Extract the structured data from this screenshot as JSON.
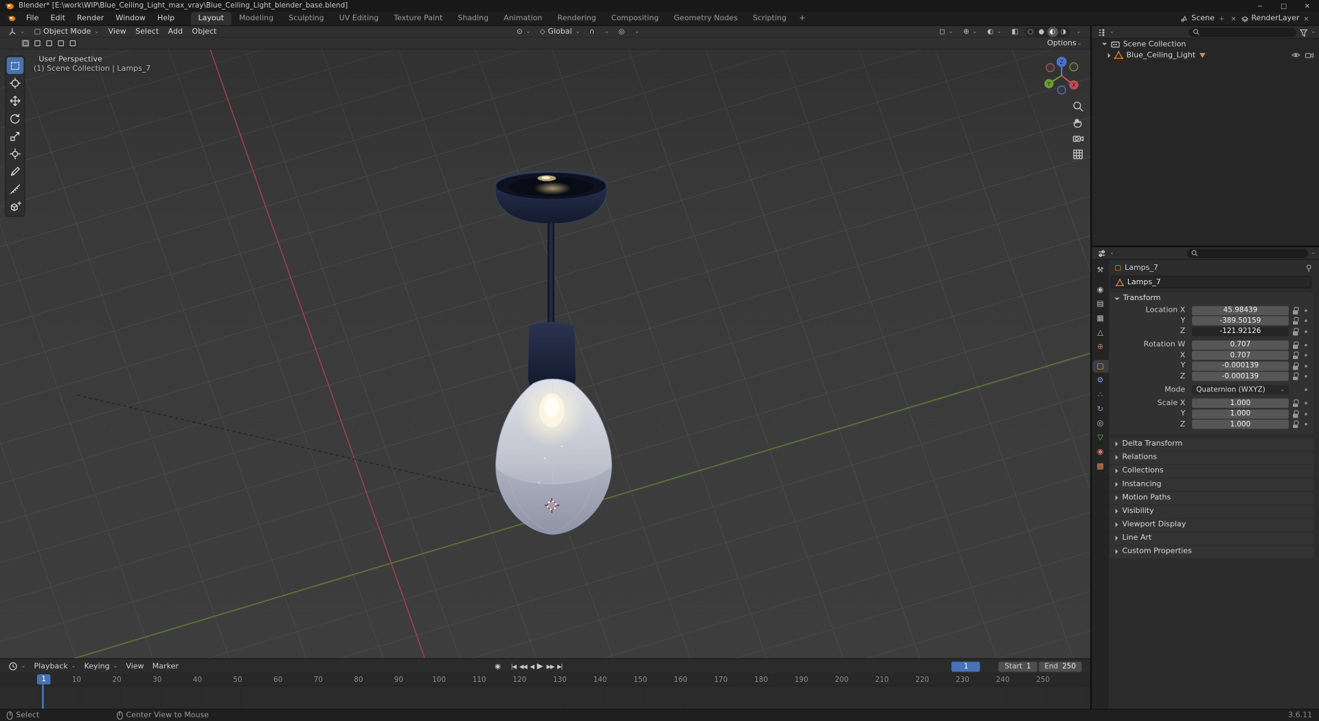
{
  "window": {
    "title": "Blender* [E:\\work\\WIP\\Blue_Ceiling_Light_max_vray\\Blue_Ceiling_Light_blender_base.blend]",
    "minimize": "−",
    "maximize": "□",
    "close": "✕"
  },
  "topbar": {
    "menus": [
      "File",
      "Edit",
      "Render",
      "Window",
      "Help"
    ],
    "workspaces": [
      "Layout",
      "Modeling",
      "Sculpting",
      "UV Editing",
      "Texture Paint",
      "Shading",
      "Animation",
      "Rendering",
      "Compositing",
      "Geometry Nodes",
      "Scripting"
    ],
    "add_tab": "+",
    "scene_label": "Scene",
    "viewlayer_label": "RenderLayer"
  },
  "viewport": {
    "mode": "Object Mode",
    "menus": [
      "View",
      "Select",
      "Add",
      "Object"
    ],
    "orientation": "Global",
    "options_label": "Options",
    "overlay_title": "User Perspective",
    "overlay_context": "(1) Scene Collection | Lamps_7",
    "gizmo": {
      "x": "X",
      "y": "Y",
      "z": "Z"
    },
    "tools": [
      "select-box",
      "cursor-3d",
      "move",
      "rotate",
      "scale",
      "transform",
      "annotate",
      "measure",
      "add-cube"
    ]
  },
  "outliner": {
    "scene_collection": "Scene Collection",
    "object_name": "Blue_Ceiling_Light"
  },
  "properties": {
    "breadcrumb": "Lamps_7",
    "name_field": "Lamps_7",
    "transform_title": "Transform",
    "rows": [
      {
        "label": "Location X",
        "value": "45.98439"
      },
      {
        "label": "Y",
        "value": "-389.50159"
      },
      {
        "label": "Z",
        "value": "-121.92126"
      },
      {
        "label": "Rotation W",
        "value": "0.707"
      },
      {
        "label": "X",
        "value": "0.707"
      },
      {
        "label": "Y",
        "value": "-0.000139"
      },
      {
        "label": "Z",
        "value": "-0.000139"
      },
      {
        "label": "Mode",
        "value": "Quaternion (WXYZ)"
      },
      {
        "label": "Scale X",
        "value": "1.000"
      },
      {
        "label": "Y",
        "value": "1.000"
      },
      {
        "label": "Z",
        "value": "1.000"
      }
    ],
    "panels": [
      "Delta Transform",
      "Relations",
      "Collections",
      "Instancing",
      "Motion Paths",
      "Visibility",
      "Viewport Display",
      "Line Art",
      "Custom Properties"
    ],
    "tabs": [
      {
        "name": "tool",
        "glyph": "⚒",
        "color": "#bdbdbd"
      },
      {
        "name": "render",
        "glyph": "◉",
        "color": "#bdbdbd",
        "gap_before": true
      },
      {
        "name": "output",
        "glyph": "▤",
        "color": "#bdbdbd"
      },
      {
        "name": "view-layer",
        "glyph": "▦",
        "color": "#bdbdbd"
      },
      {
        "name": "scene",
        "glyph": "△",
        "color": "#bdbdbd"
      },
      {
        "name": "world",
        "glyph": "⊕",
        "color": "#c27b6f"
      },
      {
        "name": "object",
        "glyph": "▢",
        "color": "#e8a04c",
        "active": true,
        "gap_before": true
      },
      {
        "name": "modifiers",
        "glyph": "⚙",
        "color": "#7ba7d9"
      },
      {
        "name": "particles",
        "glyph": "∴",
        "color": "#7ba7d9"
      },
      {
        "name": "physics",
        "glyph": "↻",
        "color": "#7ba7d9"
      },
      {
        "name": "constraints",
        "glyph": "◎",
        "color": "#bdbdbd"
      },
      {
        "name": "object-data",
        "glyph": "▽",
        "color": "#6fbf5a"
      },
      {
        "name": "material",
        "glyph": "◉",
        "color": "#d97b7b"
      },
      {
        "name": "texture",
        "glyph": "▩",
        "color": "#d98a5f"
      }
    ]
  },
  "timeline": {
    "menus": [
      "Playback",
      "Keying",
      "View",
      "Marker"
    ],
    "autokey": "◉",
    "transport": [
      "|◀",
      "◀◀",
      "◀",
      "▶",
      "▶▶",
      "▶|"
    ],
    "current_frame": "1",
    "start_label": "Start",
    "start_value": "1",
    "end_label": "End",
    "end_value": "250",
    "ruler": [
      10,
      20,
      30,
      40,
      50,
      60,
      70,
      80,
      90,
      100,
      110,
      120,
      130,
      140,
      150,
      160,
      170,
      180,
      190,
      200,
      210,
      220,
      230,
      240,
      250
    ]
  },
  "statusbar": {
    "hint_select": "Select",
    "hint_center": "Center View to Mouse",
    "version": "3.6.11"
  },
  "colors": {
    "accent": "#4772b3",
    "axis_x": "#a2424f",
    "axis_y": "#5c7d2b",
    "mesh_orange": "#e0883a"
  }
}
